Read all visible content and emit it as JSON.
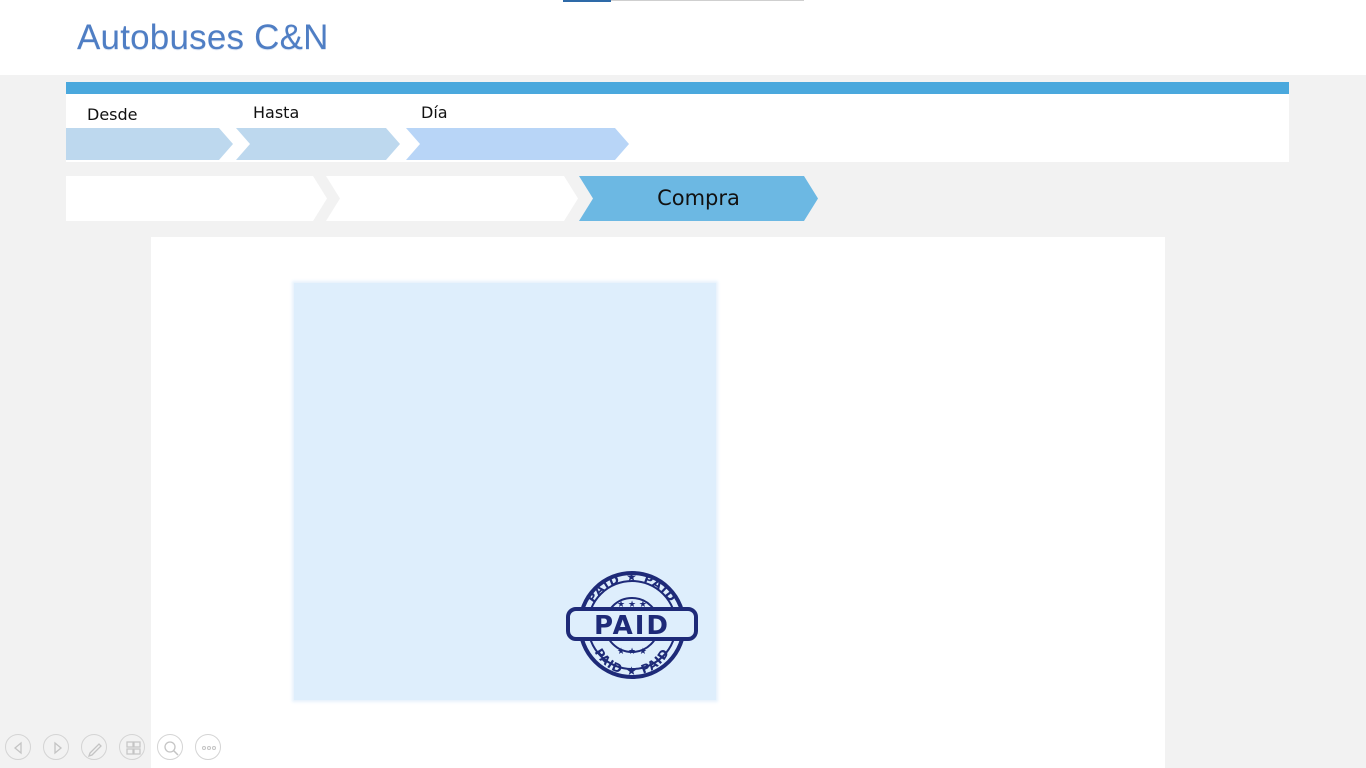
{
  "app": {
    "title": "Autobuses C&N"
  },
  "top_progress": {
    "fraction": 0.2
  },
  "search": {
    "desde_label": "Desde",
    "hasta_label": "Hasta",
    "dia_label": "Día",
    "desde_value": "",
    "hasta_value": "",
    "dia_value": ""
  },
  "steps": [
    {
      "label": "",
      "active": false
    },
    {
      "label": "",
      "active": false
    },
    {
      "label": "Compra",
      "active": true
    }
  ],
  "ticket": {
    "stamp_text": "PAID",
    "stamp_ring_text": "PAID ★ PAID"
  },
  "colors": {
    "accent": "#4aa8dd",
    "title": "#4f7ec4",
    "active_step": "#6cb8e3",
    "ticket_bg": "#deeefc",
    "stamp": "#1e2a78"
  },
  "nav_controls": [
    {
      "icon": "previous-icon"
    },
    {
      "icon": "next-icon"
    },
    {
      "icon": "pen-icon"
    },
    {
      "icon": "slides-icon"
    },
    {
      "icon": "zoom-icon"
    },
    {
      "icon": "more-icon"
    }
  ]
}
